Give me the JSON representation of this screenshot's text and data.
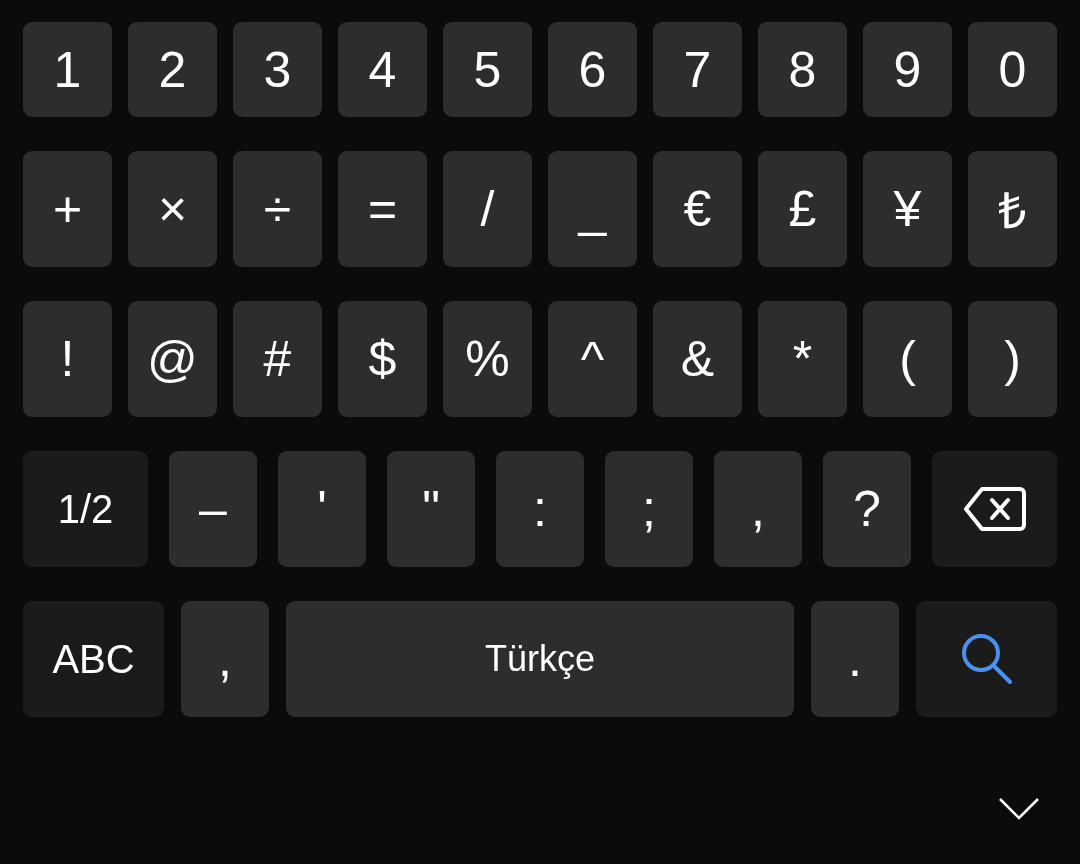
{
  "rows": [
    {
      "keys": [
        {
          "kind": "char",
          "label": "1"
        },
        {
          "kind": "char",
          "label": "2"
        },
        {
          "kind": "char",
          "label": "3"
        },
        {
          "kind": "char",
          "label": "4"
        },
        {
          "kind": "char",
          "label": "5"
        },
        {
          "kind": "char",
          "label": "6"
        },
        {
          "kind": "char",
          "label": "7"
        },
        {
          "kind": "char",
          "label": "8"
        },
        {
          "kind": "char",
          "label": "9"
        },
        {
          "kind": "char",
          "label": "0"
        }
      ]
    },
    {
      "keys": [
        {
          "kind": "char",
          "label": "+"
        },
        {
          "kind": "char",
          "label": "×"
        },
        {
          "kind": "char",
          "label": "÷"
        },
        {
          "kind": "char",
          "label": "="
        },
        {
          "kind": "char",
          "label": "/"
        },
        {
          "kind": "char",
          "label": "_"
        },
        {
          "kind": "char",
          "label": "€"
        },
        {
          "kind": "char",
          "label": "£"
        },
        {
          "kind": "char",
          "label": "¥"
        },
        {
          "kind": "char",
          "label": "₺"
        }
      ]
    },
    {
      "keys": [
        {
          "kind": "char",
          "label": "!"
        },
        {
          "kind": "char",
          "label": "@"
        },
        {
          "kind": "char",
          "label": "#"
        },
        {
          "kind": "char",
          "label": "$"
        },
        {
          "kind": "char",
          "label": "%"
        },
        {
          "kind": "char",
          "label": "^"
        },
        {
          "kind": "char",
          "label": "&"
        },
        {
          "kind": "char",
          "label": "*"
        },
        {
          "kind": "char",
          "label": "("
        },
        {
          "kind": "char",
          "label": ")"
        }
      ]
    },
    {
      "keys": [
        {
          "kind": "function",
          "label": "1/2"
        },
        {
          "kind": "char",
          "label": "–"
        },
        {
          "kind": "char",
          "label": "'"
        },
        {
          "kind": "char",
          "label": "\""
        },
        {
          "kind": "char",
          "label": ":"
        },
        {
          "kind": "char",
          "label": ";"
        },
        {
          "kind": "char",
          "label": ","
        },
        {
          "kind": "char",
          "label": "?"
        },
        {
          "kind": "backspace"
        }
      ]
    },
    {
      "keys": [
        {
          "kind": "function",
          "label": "ABC"
        },
        {
          "kind": "char",
          "label": ","
        },
        {
          "kind": "space",
          "label": "Türkçe"
        },
        {
          "kind": "char",
          "label": "."
        },
        {
          "kind": "search"
        }
      ]
    }
  ]
}
